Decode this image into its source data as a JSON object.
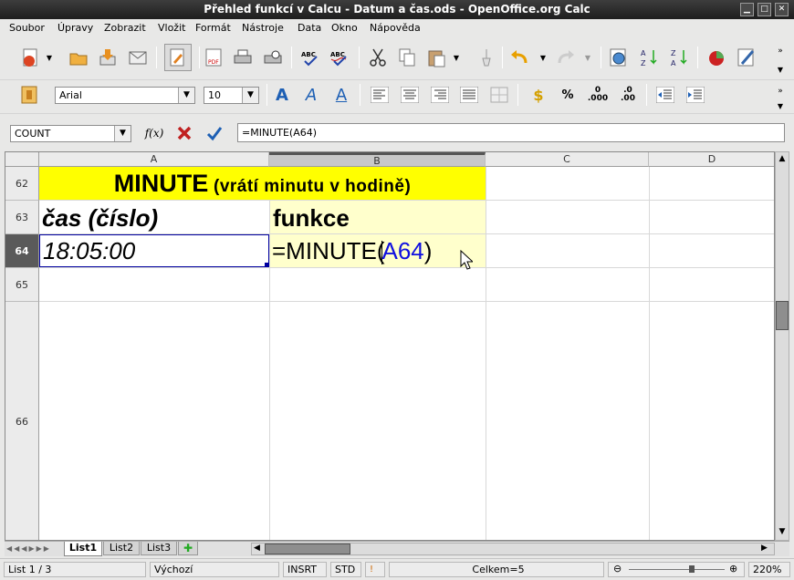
{
  "window": {
    "title": "Přehled funkcí v Calcu - Datum a čas.ods - OpenOffice.org Calc"
  },
  "menu": [
    "Soubor",
    "Úpravy",
    "Zobrazit",
    "Vložit",
    "Formát",
    "Nástroje",
    "Data",
    "Okno",
    "Nápověda"
  ],
  "toolbar2": {
    "font_name": "Arial",
    "font_size": "10"
  },
  "formula_bar": {
    "name_box": "COUNT",
    "fx_label": "f(x)",
    "formula": "=MINUTE(A64)"
  },
  "columns": [
    "A",
    "B",
    "C",
    "D"
  ],
  "rows": [
    "62",
    "63",
    "64",
    "65",
    "66"
  ],
  "cells": {
    "title_main": "MINUTE",
    "title_sub": " (vrátí minutu v hodině)",
    "a63": "čas (číslo)",
    "b63": "funkce",
    "a64": "18:05:00",
    "b64_fn": "=MINUTE(",
    "b64_ref": "A64",
    "b64_close": ")"
  },
  "sheet_tabs": [
    "List1",
    "List2",
    "List3"
  ],
  "status": {
    "sheet": "List 1 / 3",
    "style": "Výchozí",
    "insert": "INSRT",
    "selection": "STD",
    "sum": "Celkem=5",
    "zoom": "220%"
  },
  "colors": {
    "title_bg": "#ffff00",
    "light_yellow": "#ffffcc",
    "ref_blue": "#1010e0",
    "selection": "#0000a0"
  }
}
